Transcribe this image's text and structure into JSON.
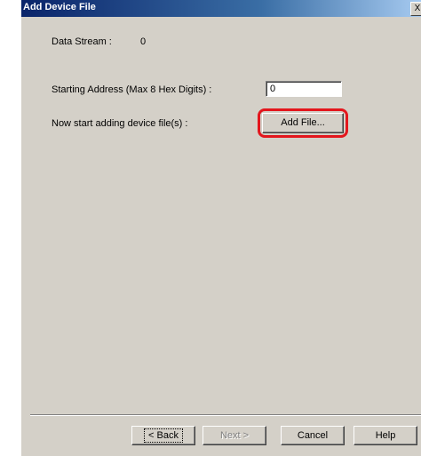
{
  "window": {
    "title": "Add Device File",
    "close_glyph": "X"
  },
  "form": {
    "data_stream_label": "Data Stream :",
    "data_stream_value": "0",
    "starting_address_label": "Starting Address (Max 8 Hex Digits) :",
    "starting_address_value": "0",
    "add_files_prompt": "Now start adding device file(s) :",
    "add_file_button": "Add File..."
  },
  "footer": {
    "back_label": "< Back",
    "next_label": "Next >",
    "cancel_label": "Cancel",
    "help_label": "Help"
  },
  "colors": {
    "highlight": "#e3161d",
    "dialog_bg": "#d4d0c8",
    "titlebar": "#0a246a"
  }
}
